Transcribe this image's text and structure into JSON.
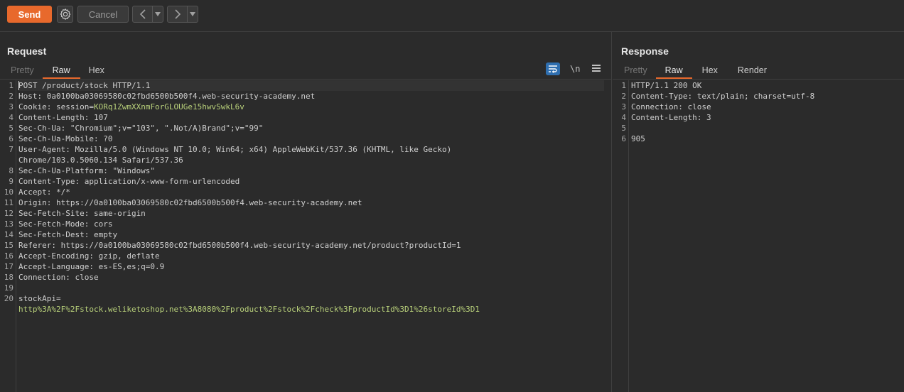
{
  "toolbar": {
    "send_label": "Send",
    "cancel_label": "Cancel",
    "icons": [
      "gear-icon",
      "back-arrow-icon",
      "back-dropdown-icon",
      "forward-arrow-icon",
      "forward-dropdown-icon"
    ],
    "accent_color": "#e8692c"
  },
  "request": {
    "title": "Request",
    "tabs": [
      "Pretty",
      "Raw",
      "Hex"
    ],
    "active_tab": "Raw",
    "tool_label_newline": "\\n",
    "lines": [
      {
        "n": "1",
        "k": "POST /product/stock HTTP/1.1",
        "v": ""
      },
      {
        "n": "2",
        "k": "Host: 0a0100ba03069580c02fbd6500b500f4.web-security-academy.net",
        "v": ""
      },
      {
        "n": "3",
        "k": "Cookie: session=",
        "v": "KORq1ZwmXXnmForGLOUGe15hwvSwkL6v"
      },
      {
        "n": "4",
        "k": "Content-Length: 107",
        "v": ""
      },
      {
        "n": "5",
        "k": "Sec-Ch-Ua: \"Chromium\";v=\"103\", \".Not/A)Brand\";v=\"99\"",
        "v": ""
      },
      {
        "n": "6",
        "k": "Sec-Ch-Ua-Mobile: ?0",
        "v": ""
      },
      {
        "n": "7",
        "k": "User-Agent: Mozilla/5.0 (Windows NT 10.0; Win64; x64) AppleWebKit/537.36 (KHTML, like Gecko)",
        "v": ""
      },
      {
        "n": "",
        "k": "Chrome/103.0.5060.134 Safari/537.36",
        "v": ""
      },
      {
        "n": "8",
        "k": "Sec-Ch-Ua-Platform: \"Windows\"",
        "v": ""
      },
      {
        "n": "9",
        "k": "Content-Type: application/x-www-form-urlencoded",
        "v": ""
      },
      {
        "n": "10",
        "k": "Accept: */*",
        "v": ""
      },
      {
        "n": "11",
        "k": "Origin: https://0a0100ba03069580c02fbd6500b500f4.web-security-academy.net",
        "v": ""
      },
      {
        "n": "12",
        "k": "Sec-Fetch-Site: same-origin",
        "v": ""
      },
      {
        "n": "13",
        "k": "Sec-Fetch-Mode: cors",
        "v": ""
      },
      {
        "n": "14",
        "k": "Sec-Fetch-Dest: empty",
        "v": ""
      },
      {
        "n": "15",
        "k": "Referer: https://0a0100ba03069580c02fbd6500b500f4.web-security-academy.net/product?productId=1",
        "v": ""
      },
      {
        "n": "16",
        "k": "Accept-Encoding: gzip, deflate",
        "v": ""
      },
      {
        "n": "17",
        "k": "Accept-Language: es-ES,es;q=0.9",
        "v": ""
      },
      {
        "n": "18",
        "k": "Connection: close",
        "v": ""
      },
      {
        "n": "19",
        "k": "",
        "v": ""
      },
      {
        "n": "20",
        "k": "stockApi=",
        "v": ""
      },
      {
        "n": "",
        "k": "",
        "v": "http%3A%2F%2Fstock.weliketoshop.net%3A8080%2Fproduct%2Fstock%2Fcheck%3FproductId%3D1%26storeId%3D1"
      }
    ]
  },
  "response": {
    "title": "Response",
    "tabs": [
      "Pretty",
      "Raw",
      "Hex",
      "Render"
    ],
    "active_tab": "Raw",
    "lines": [
      {
        "n": "1",
        "k": "HTTP/1.1 200 OK",
        "v": ""
      },
      {
        "n": "2",
        "k": "Content-Type: text/plain; charset=utf-8",
        "v": ""
      },
      {
        "n": "3",
        "k": "Connection: close",
        "v": ""
      },
      {
        "n": "4",
        "k": "Content-Length: 3",
        "v": ""
      },
      {
        "n": "5",
        "k": "",
        "v": ""
      },
      {
        "n": "6",
        "k": "905",
        "v": ""
      }
    ]
  }
}
